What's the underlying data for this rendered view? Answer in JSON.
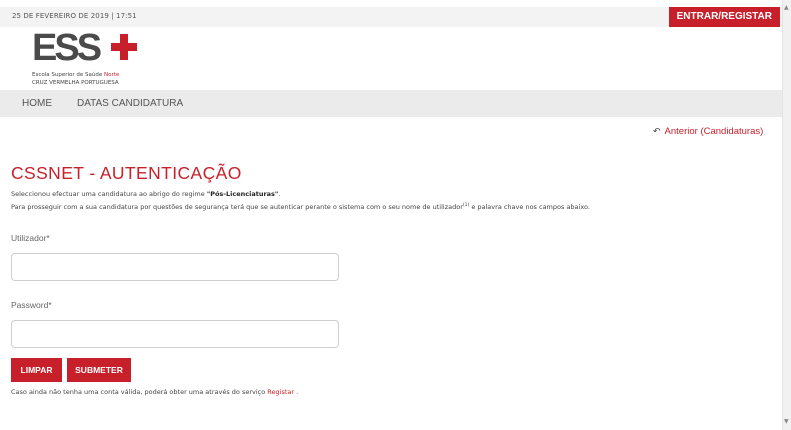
{
  "header": {
    "date": "25 DE FEVEREIRO DE 2019 | 17:51",
    "login_label": "ENTRAR/REGISTAR"
  },
  "logo": {
    "text": "ESS",
    "line1_pre": "Escola Superior de Saúde ",
    "line1_accent": "Norte",
    "line2": "CRUZ VERMELHA PORTUGUESA"
  },
  "nav": {
    "items": [
      {
        "label": "HOME"
      },
      {
        "label": "DATAS CANDIDATURA"
      }
    ]
  },
  "back_link": "Anterior (Candidaturas)",
  "title": "CSSNET - AUTENTICAÇÃO",
  "intro": {
    "line1_pre": "Seleccionou efectuar uma candidatura ao abrigo do regime ",
    "line1_bold": "\"Pós-Licenciaturas\"",
    "line1_post": ".",
    "line2_pre": "Para prosseguir com a sua candidatura por questões de segurança terá que se autenticar perante o sistema com o seu nome de utilizador",
    "line2_sup": "(1)",
    "line2_post": " e palavra chave nos campos abaixo."
  },
  "form": {
    "user_label": "Utilizador*",
    "user_value": "",
    "password_label": "Password*",
    "password_value": "",
    "clear_label": "LIMPAR",
    "submit_label": "SUBMETER"
  },
  "footer": {
    "note_pre": "Caso ainda não tenha uma conta válida, poderá obter uma através do serviço ",
    "note_link": "Registar",
    "note_post": " ."
  },
  "colors": {
    "accent": "#c8202a",
    "nav_bg": "#ebebeb",
    "topbar_bg": "#f3f3f3"
  }
}
